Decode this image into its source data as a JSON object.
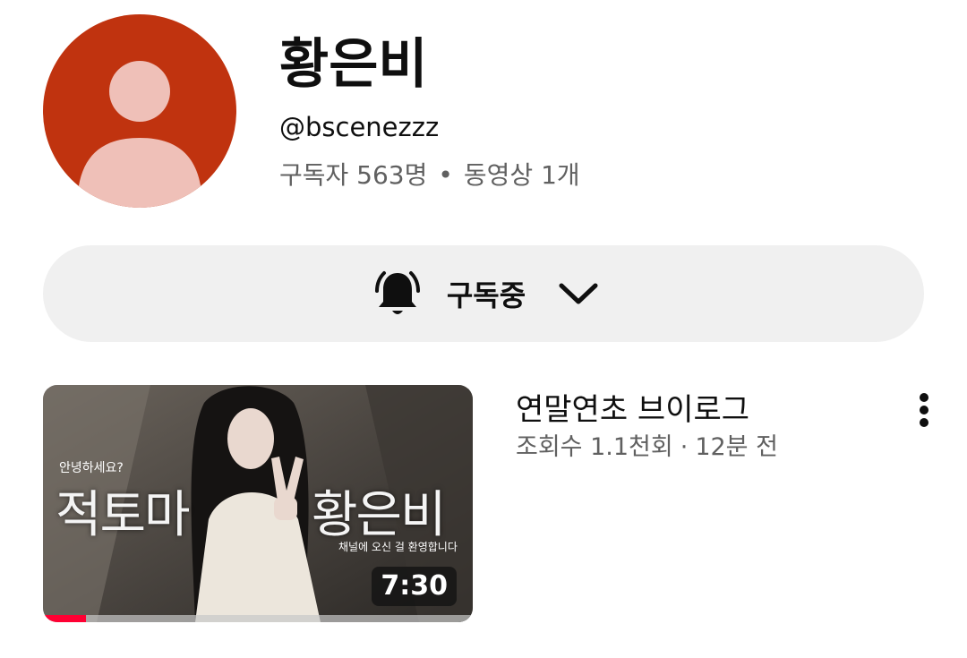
{
  "channel": {
    "name": "황은비",
    "handle": "@bscenezzz",
    "subscribers": "구독자 563명",
    "separator": "•",
    "video_count": "동영상 1개",
    "avatar_color": "#c0330f"
  },
  "subscribe": {
    "label": "구독중",
    "bell_icon": "bell-icon",
    "chevron_icon": "chevron-down-icon"
  },
  "video": {
    "title": "연말연초 브이로그",
    "views": "조회수 1.1천회",
    "separator": "·",
    "age": "12분 전",
    "duration": "7:30",
    "watched_fraction": 0.1,
    "thumbnail_text": {
      "greeting": "안녕하세요?",
      "left_title": "적토마",
      "right_title": "황은비",
      "welcome": "채널에 오신 걸 환영합니다"
    },
    "menu_icon": "more-vert-icon"
  }
}
